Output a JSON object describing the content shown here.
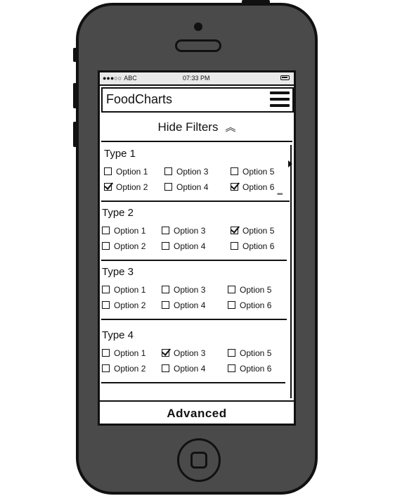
{
  "status_bar": {
    "signal": "●●●○○",
    "carrier": "ABC",
    "time": "07:33 PM"
  },
  "navbar": {
    "title": "FoodCharts",
    "menu_icon": "hamburger-menu-icon"
  },
  "filter_toggle": {
    "label": "Hide Filters",
    "icon": "double-chevron-up-icon",
    "glyph": "︽"
  },
  "groups": [
    {
      "title": "Type 1",
      "options": [
        {
          "label": "Option 1",
          "checked": false
        },
        {
          "label": "Option 2",
          "checked": true
        },
        {
          "label": "Option 3",
          "checked": false
        },
        {
          "label": "Option 4",
          "checked": false
        },
        {
          "label": "Option 5",
          "checked": false
        },
        {
          "label": "Option 6",
          "checked": true
        }
      ]
    },
    {
      "title": "Type 2",
      "options": [
        {
          "label": "Option 1",
          "checked": false
        },
        {
          "label": "Option 2",
          "checked": false
        },
        {
          "label": "Option 3",
          "checked": false
        },
        {
          "label": "Option 4",
          "checked": false
        },
        {
          "label": "Option 5",
          "checked": true
        },
        {
          "label": "Option 6",
          "checked": false
        }
      ]
    },
    {
      "title": "Type 3",
      "options": [
        {
          "label": "Option 1",
          "checked": false
        },
        {
          "label": "Option 2",
          "checked": false
        },
        {
          "label": "Option 3",
          "checked": false
        },
        {
          "label": "Option 4",
          "checked": false
        },
        {
          "label": "Option 5",
          "checked": false
        },
        {
          "label": "Option 6",
          "checked": false
        }
      ]
    },
    {
      "title": "Type 4",
      "options": [
        {
          "label": "Option 1",
          "checked": false
        },
        {
          "label": "Option 2",
          "checked": false
        },
        {
          "label": "Option 3",
          "checked": true
        },
        {
          "label": "Option 4",
          "checked": false
        },
        {
          "label": "Option 5",
          "checked": false
        },
        {
          "label": "Option 6",
          "checked": false
        }
      ]
    }
  ],
  "footer": {
    "advanced_label": "Advanced"
  },
  "colors": {
    "phone_body": "#4a4a4a",
    "outline": "#111111",
    "status_bar_bg": "#e9e9e9"
  }
}
